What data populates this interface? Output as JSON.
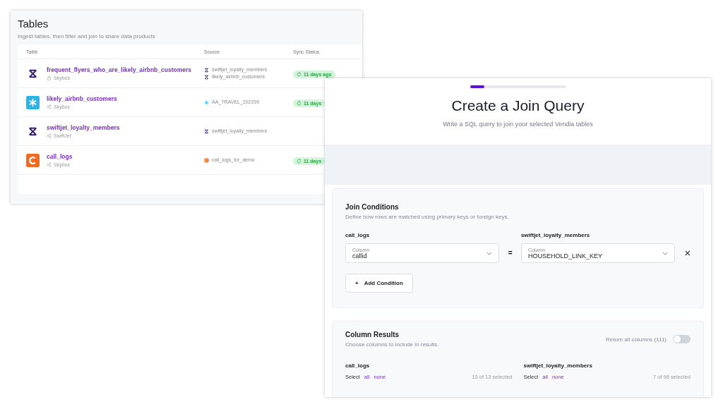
{
  "tables_panel": {
    "title": "Tables",
    "subtitle": "Ingest tables, then filter and join to share data products",
    "columns": [
      "Table",
      "Source",
      "Sync Status"
    ],
    "rows": [
      {
        "kind": "vendia",
        "name": "frequent_flyers_who_are_likely_airbnb_customers",
        "owner": "Skybus",
        "shared": false,
        "sources": [
          {
            "kind": "vendia",
            "name": "swiftjet_loyalty_members"
          },
          {
            "kind": "vendia",
            "name": "likely_airbnb_customers"
          }
        ],
        "sync": "11 days ago"
      },
      {
        "kind": "snowflake",
        "name": "likely_airbnb_customers",
        "owner": "Skybus",
        "shared": true,
        "sources": [
          {
            "kind": "snowflake",
            "name": "AA_TRAVEL_202209"
          }
        ],
        "sync": "11 days"
      },
      {
        "kind": "vendia",
        "name": "swiftjet_loyalty_members",
        "owner": "SwiftJet",
        "shared": true,
        "sources": [
          {
            "kind": "vendia",
            "name": "swiftjet_loyalty_members"
          }
        ]
      },
      {
        "kind": "custom",
        "name": "call_logs",
        "owner": "Skybus",
        "shared": true,
        "sources": [
          {
            "kind": "custom",
            "name": "call_logs_for_demo"
          }
        ],
        "sync": "11 days"
      }
    ]
  },
  "join_dialog": {
    "progress": {
      "level": 0.15
    },
    "title": "Create a Join Query",
    "subtitle": "Write a SQL query to join your selected Vendia tables",
    "join_conditions": {
      "title": "Join Conditions",
      "subtitle": "Define how rows are matched using primary keys or foreign keys.",
      "left": {
        "table": "call_logs",
        "label": "Column",
        "value": "callid"
      },
      "operator": "=",
      "right": {
        "table": "swiftjet_loyalty_members",
        "label": "Column",
        "value": "HOUSEHOLD_LINK_KEY"
      },
      "add_button": "Add Condition",
      "add_icon": "+"
    },
    "column_results": {
      "title": "Column Results",
      "subtitle": "Choose columns to include in results.",
      "toggle_label": "Return all columns (111)",
      "toggle_on": false,
      "tables": [
        {
          "name": "call_logs",
          "select": "Select",
          "all": "all",
          "none": "none",
          "count": "13 of 13 selected"
        },
        {
          "name": "swiftjet_loyalty_members",
          "select": "Select",
          "all": "all",
          "none": "none",
          "count": "7 of 98 selected"
        }
      ]
    }
  }
}
